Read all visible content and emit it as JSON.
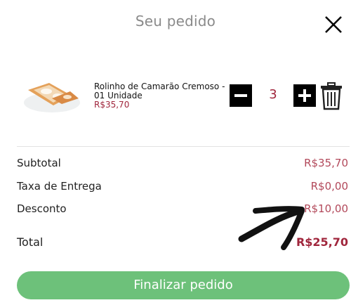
{
  "header": {
    "title": "Seu pedido"
  },
  "cart": {
    "items": [
      {
        "name": "Rolinho de Camarão Cremoso - 01 Unidade",
        "price": "R$35,70",
        "quantity": "3"
      }
    ]
  },
  "summary": {
    "subtotal_label": "Subtotal",
    "subtotal_value": "R$35,70",
    "delivery_label": "Taxa de Entrega",
    "delivery_value": "R$0,00",
    "discount_label": "Desconto",
    "discount_value": "R$10,00",
    "total_label": "Total",
    "total_value": "R$25,70"
  },
  "footer": {
    "checkout_label": "Finalizar pedido"
  },
  "icons": {
    "close": "close-icon",
    "minus": "minus-icon",
    "plus": "plus-icon",
    "trash": "trash-icon",
    "annotation": "arrow-annotation"
  },
  "colors": {
    "accent": "#a0263c",
    "value_text": "#b2485a",
    "checkout_button": "#6dc17a",
    "title_gray": "#8a8a8a"
  }
}
